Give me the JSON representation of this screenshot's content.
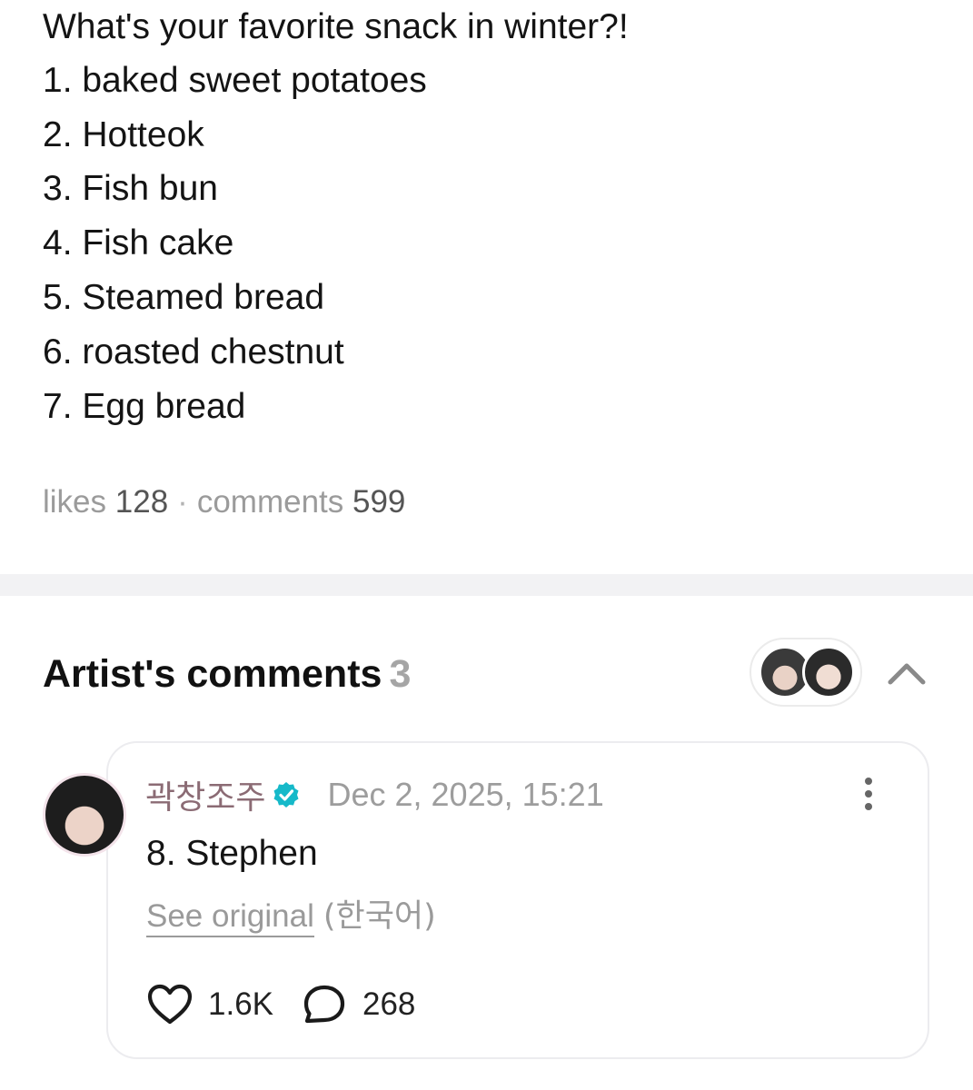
{
  "post": {
    "lines": [
      "What's your favorite snack in winter?!",
      "1. baked sweet potatoes",
      "2. Hotteok",
      "3. Fish bun",
      "4. Fish cake",
      "5. Steamed bread",
      "6. roasted chestnut",
      "7. Egg bread"
    ],
    "likes_label": "likes",
    "likes_count": "128",
    "separator": "·",
    "comments_label": "comments",
    "comments_count": "599"
  },
  "artist_comments": {
    "title": "Artist's comments",
    "count": "3",
    "comment": {
      "author": "곽창조주",
      "timestamp": "Dec 2, 2025, 15:21",
      "body": "8. Stephen",
      "see_original_label": "See original",
      "original_language": "(한국어)",
      "like_count": "1.6K",
      "reply_count": "268"
    }
  },
  "colors": {
    "verified_badge": "#16b9c9",
    "author_name": "#8b6b74",
    "divider": "#f2f2f4"
  },
  "icons": {
    "verified": "verified-badge-icon",
    "more": "more-vertical-icon",
    "collapse": "chevron-up-icon",
    "like": "heart-icon",
    "reply": "comment-bubble-icon"
  }
}
